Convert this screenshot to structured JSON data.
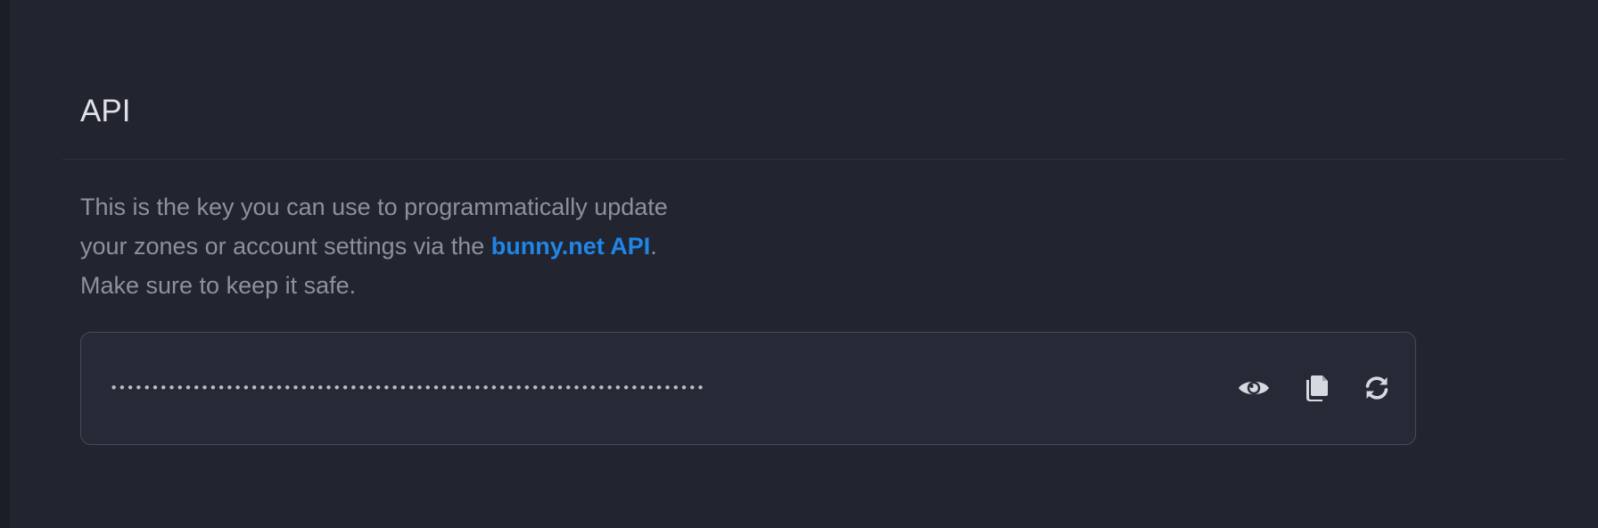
{
  "section": {
    "title": "API"
  },
  "description": {
    "before_link": "This is the key you can use to programmatically update your zones or account settings via the ",
    "link_text": "bunny.net API",
    "after_link": ". Make sure to keep it safe."
  },
  "api_key": {
    "masked_value": "••••••••••••••••••••••••••••••••••••••••••••••••••••••••••••••••••••••••",
    "actions": [
      {
        "icon": "eye-icon"
      },
      {
        "icon": "copy-icon"
      },
      {
        "icon": "refresh-icon"
      }
    ]
  },
  "colors": {
    "background": "#22242f",
    "link": "#1f86e8",
    "icon": "#d7d9e0"
  }
}
